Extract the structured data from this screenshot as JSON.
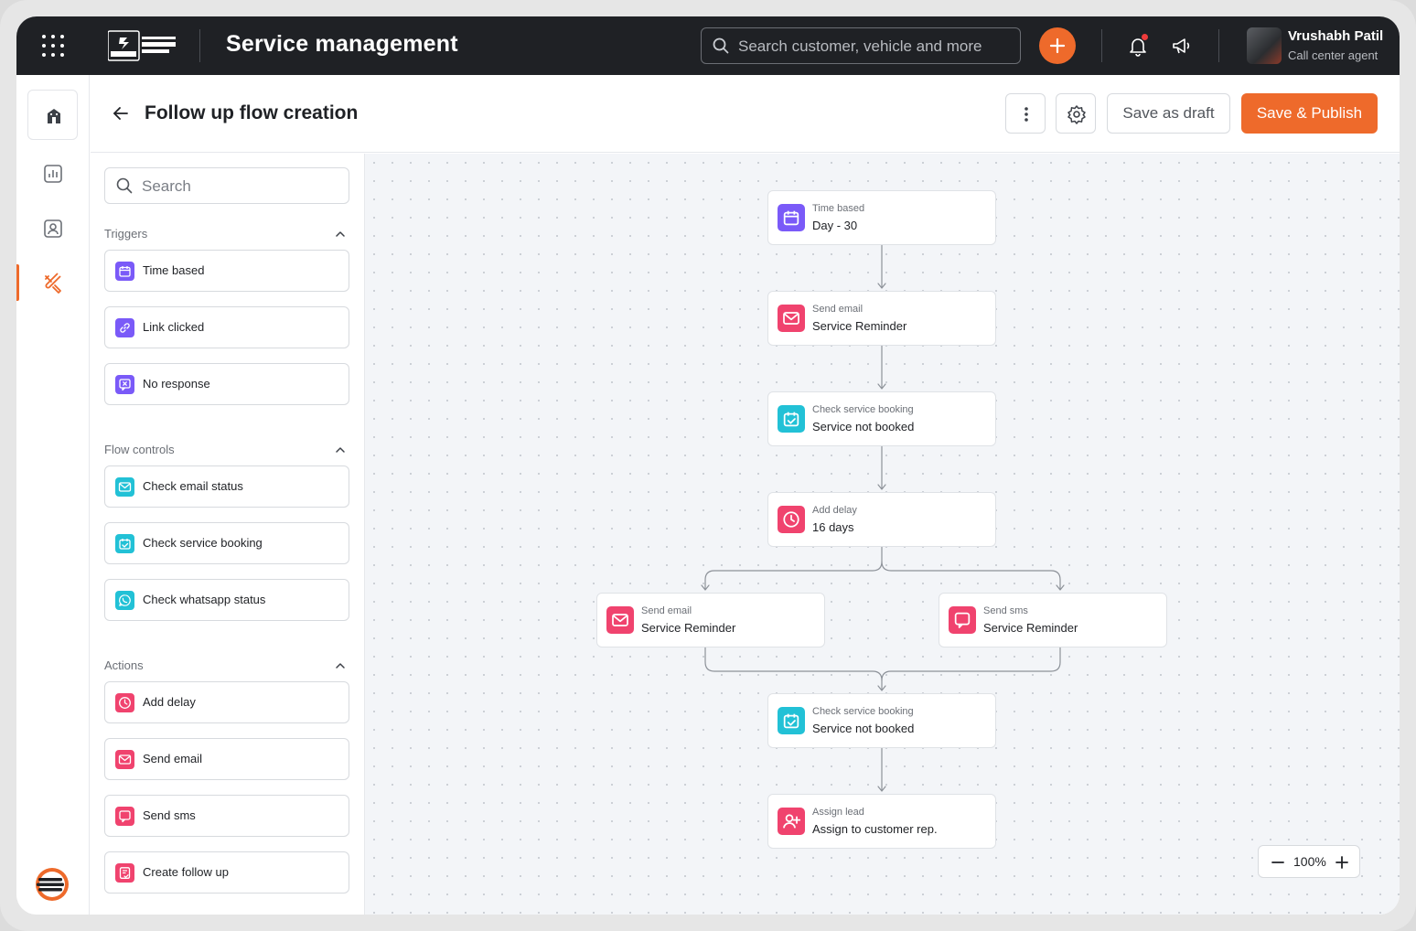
{
  "app": {
    "title": "Service management",
    "search_placeholder": "Search customer, vehicle and more",
    "brand_colors": {
      "accent": "#ee6a2b",
      "topbar": "#1f2125"
    },
    "user": {
      "name": "Vrushabh Patil",
      "role": "Call center agent"
    }
  },
  "page": {
    "title": "Follow up flow creation",
    "save_draft_label": "Save as draft",
    "publish_label": "Save & Publish"
  },
  "panel": {
    "search_placeholder": "Search",
    "sections": [
      {
        "title": "Triggers",
        "items": [
          {
            "label": "Time based",
            "icon": "calendar-icon",
            "color": "#7a5af8"
          },
          {
            "label": "Link clicked",
            "icon": "link-icon",
            "color": "#7a5af8"
          },
          {
            "label": "No response",
            "icon": "no-response-icon",
            "color": "#7a5af8"
          }
        ]
      },
      {
        "title": "Flow controls",
        "items": [
          {
            "label": "Check email status",
            "icon": "mail-icon",
            "color": "#22c1d6"
          },
          {
            "label": "Check service booking",
            "icon": "calendar-check-icon",
            "color": "#22c1d6"
          },
          {
            "label": "Check whatsapp status",
            "icon": "whatsapp-icon",
            "color": "#22c1d6"
          }
        ]
      },
      {
        "title": "Actions",
        "items": [
          {
            "label": "Add delay",
            "icon": "clock-icon",
            "color": "#f0436e"
          },
          {
            "label": "Send email",
            "icon": "mail-icon",
            "color": "#f0436e"
          },
          {
            "label": "Send sms",
            "icon": "chat-icon",
            "color": "#f0436e"
          },
          {
            "label": "Create follow up",
            "icon": "follow-up-icon",
            "color": "#f0436e"
          }
        ]
      }
    ]
  },
  "flow": {
    "nodes": [
      {
        "type": "Time based",
        "value": "Day - 30",
        "icon": "calendar-icon",
        "color": "#7a5af8"
      },
      {
        "type": "Send email",
        "value": "Service Reminder",
        "icon": "mail-icon",
        "color": "#f0436e"
      },
      {
        "type": "Check service booking",
        "value": "Service not booked",
        "icon": "calendar-check-icon",
        "color": "#22c1d6"
      },
      {
        "type": "Add delay",
        "value": "16 days",
        "icon": "clock-icon",
        "color": "#f0436e"
      },
      {
        "type": "Send email",
        "value": "Service Reminder",
        "icon": "mail-icon",
        "color": "#f0436e"
      },
      {
        "type": "Send sms",
        "value": "Service Reminder",
        "icon": "chat-icon",
        "color": "#f0436e"
      },
      {
        "type": "Check service booking",
        "value": "Service not booked",
        "icon": "calendar-check-icon",
        "color": "#22c1d6"
      },
      {
        "type": "Assign lead",
        "value": "Assign to customer rep.",
        "icon": "user-plus-icon",
        "color": "#f0436e"
      }
    ]
  },
  "zoom": {
    "level": "100%"
  }
}
